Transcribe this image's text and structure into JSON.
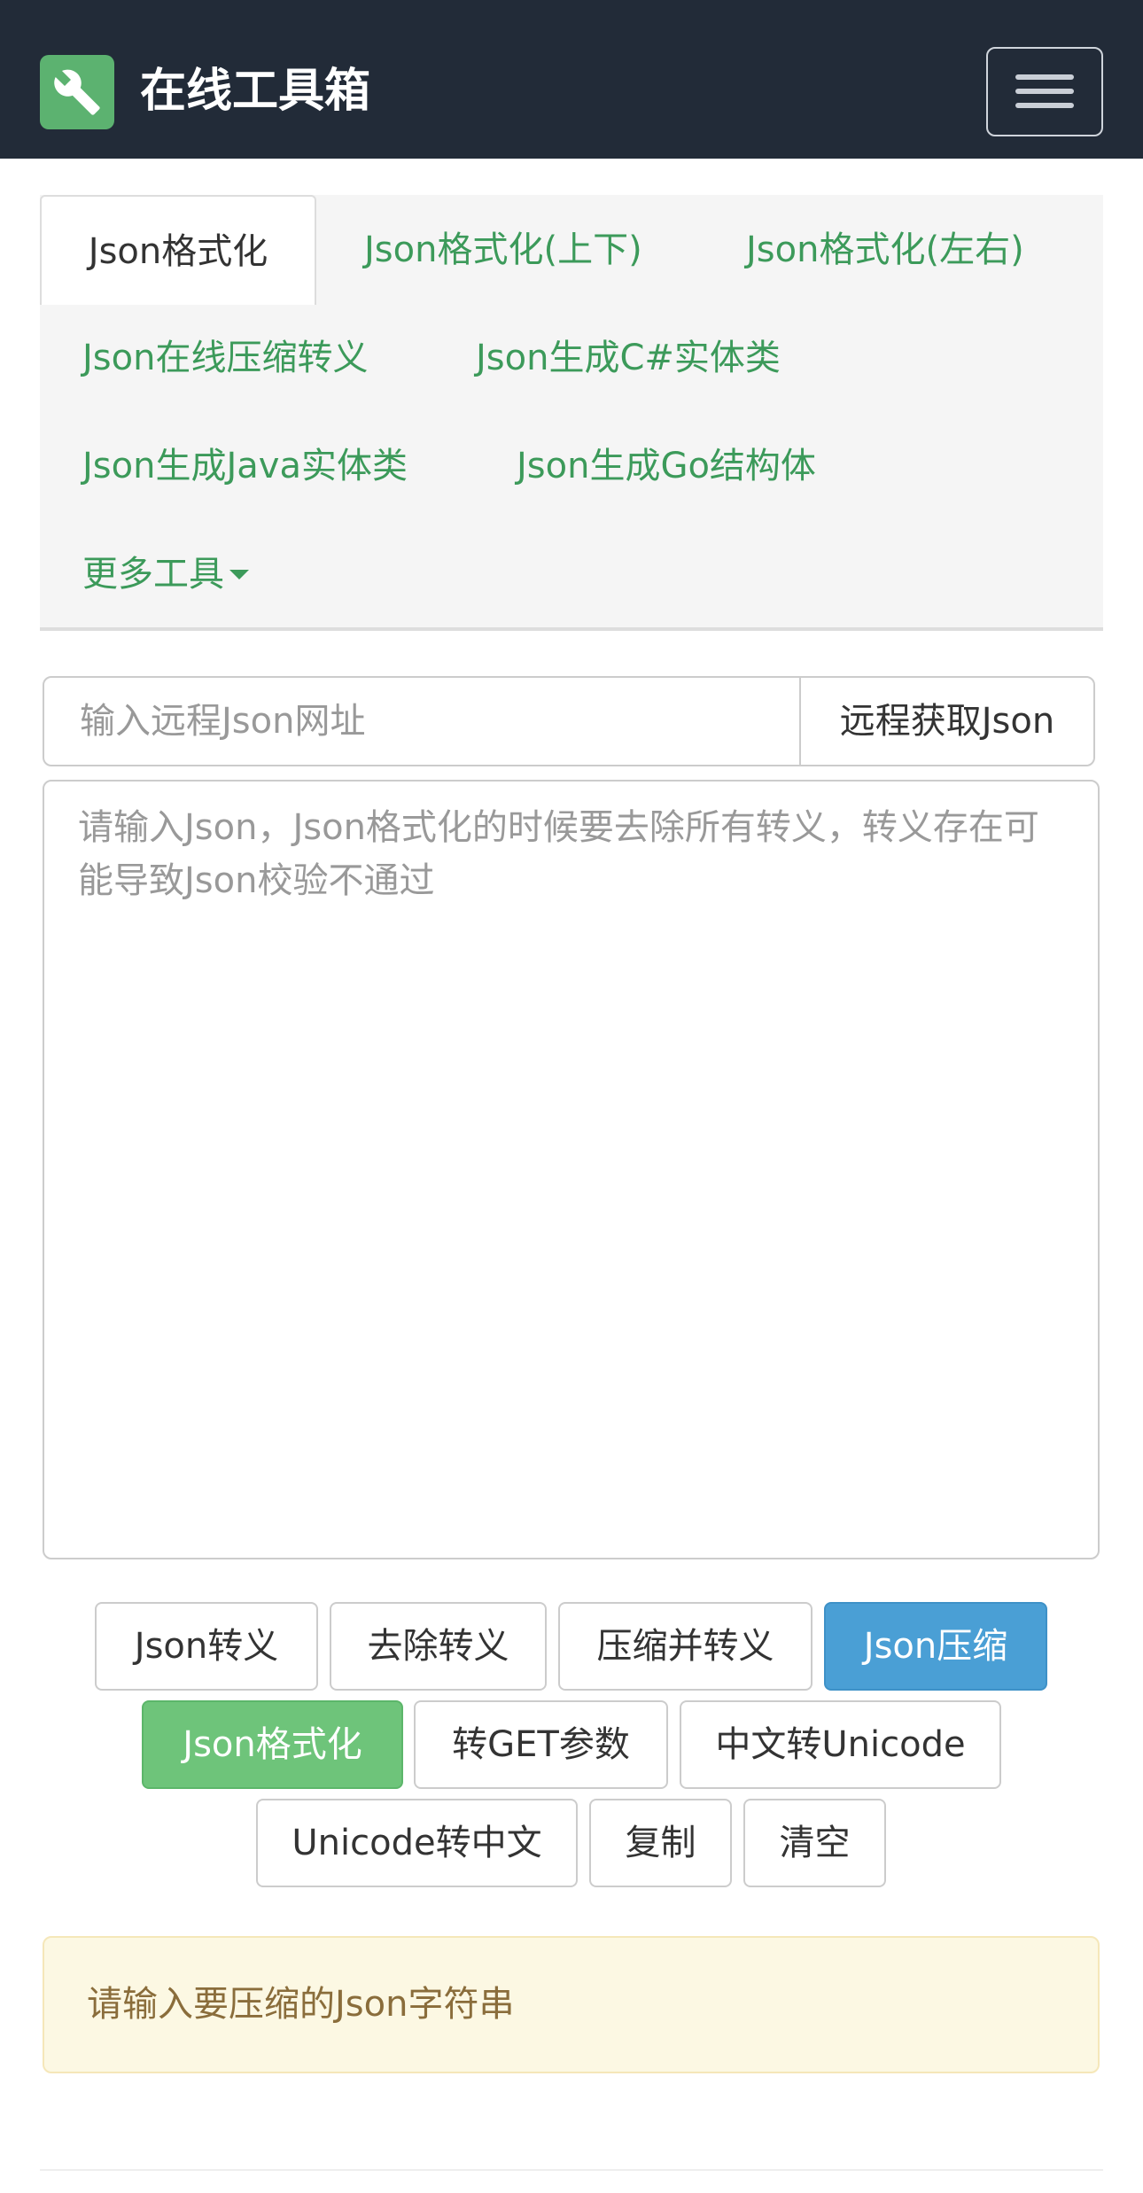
{
  "navbar": {
    "brand": "在线工具箱",
    "logo_icon": "wrench-icon",
    "menu_icon": "hamburger-menu-icon"
  },
  "tabs": {
    "items": [
      {
        "label": "Json格式化",
        "active": true
      },
      {
        "label": "Json格式化(上下)",
        "active": false
      },
      {
        "label": "Json格式化(左右)",
        "active": false
      },
      {
        "label": "Json在线压缩转义",
        "active": false
      },
      {
        "label": "Json生成C#实体类",
        "active": false
      },
      {
        "label": "Json生成Java实体类",
        "active": false
      },
      {
        "label": "Json生成Go结构体",
        "active": false
      }
    ],
    "more_label": "更多工具"
  },
  "remote": {
    "placeholder": "输入远程Json网址",
    "button_label": "远程获取Json"
  },
  "editor": {
    "placeholder": "请输入Json，Json格式化的时候要去除所有转义，转义存在可能导致Json校验不通过"
  },
  "actions": [
    {
      "label": "Json转义",
      "style": "default"
    },
    {
      "label": "去除转义",
      "style": "default"
    },
    {
      "label": "压缩并转义",
      "style": "default"
    },
    {
      "label": "Json压缩",
      "style": "primary"
    },
    {
      "label": "Json格式化",
      "style": "success"
    },
    {
      "label": "转GET参数",
      "style": "default"
    },
    {
      "label": "中文转Unicode",
      "style": "default"
    },
    {
      "label": "Unicode转中文",
      "style": "default"
    },
    {
      "label": "复制",
      "style": "default"
    },
    {
      "label": "清空",
      "style": "default"
    }
  ],
  "alert": {
    "message": "请输入要压缩的Json字符串"
  },
  "colors": {
    "navbar_bg": "#222b38",
    "logo_green": "#5cb270",
    "link_green": "#3c9a5a",
    "primary_blue": "#4a9fd5",
    "success_green": "#6ec47a",
    "warning_bg": "#fcf8e3",
    "warning_text": "#8a6d3b"
  }
}
